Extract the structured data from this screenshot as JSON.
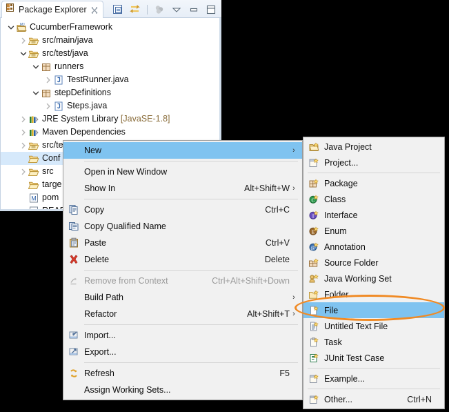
{
  "window": {
    "title": "Package Explorer",
    "accent_selection": "#7fc3f0",
    "annotation_color": "#f08a24"
  },
  "view": {
    "tab": {
      "label": "Package Explorer",
      "icon": "package-explorer-icon",
      "close_icon": "close-icon"
    },
    "toolbar": [
      {
        "name": "collapse-all-button",
        "icon": "collapse-all-icon"
      },
      {
        "name": "link-with-editor-button",
        "icon": "link-editor-icon"
      },
      {
        "name": "focus-on-active-task-button",
        "icon": "focus-task-icon"
      },
      {
        "name": "view-menu-button",
        "icon": "chevron-down-icon"
      },
      {
        "name": "minimize-button",
        "icon": "minimize-icon"
      },
      {
        "name": "maximize-button",
        "icon": "maximize-icon"
      }
    ]
  },
  "tree": [
    {
      "label": "CucumberFramework",
      "icon": "project-icon",
      "indent": 0,
      "twisty": "expanded",
      "selected": false
    },
    {
      "label": "src/main/java",
      "icon": "source-folder-icon",
      "indent": 1,
      "twisty": "collapsed",
      "selected": false
    },
    {
      "label": "src/test/java",
      "icon": "source-folder-icon",
      "indent": 1,
      "twisty": "expanded",
      "selected": false
    },
    {
      "label": "runners",
      "icon": "package-icon",
      "indent": 2,
      "twisty": "expanded",
      "selected": false
    },
    {
      "label": "TestRunner.java",
      "icon": "java-file-icon",
      "indent": 3,
      "twisty": "collapsed",
      "selected": false
    },
    {
      "label": "stepDefinitions",
      "icon": "package-icon",
      "indent": 2,
      "twisty": "expanded",
      "selected": false
    },
    {
      "label": "Steps.java",
      "icon": "java-file-icon",
      "indent": 3,
      "twisty": "collapsed",
      "selected": false
    },
    {
      "label": "JRE System Library",
      "suffix": " [JavaSE-1.8]",
      "icon": "library-icon",
      "indent": 1,
      "twisty": "collapsed",
      "selected": false
    },
    {
      "label": "Maven Dependencies",
      "icon": "library-icon",
      "indent": 1,
      "twisty": "collapsed",
      "selected": false
    },
    {
      "label": "src/test/resources",
      "icon": "source-folder-icon",
      "indent": 1,
      "twisty": "collapsed",
      "selected": false
    },
    {
      "label": "Conf",
      "icon": "folder-icon",
      "indent": 1,
      "twisty": "none",
      "selected": true
    },
    {
      "label": "src",
      "icon": "folder-icon",
      "indent": 1,
      "twisty": "collapsed",
      "selected": false
    },
    {
      "label": "targe",
      "icon": "folder-icon",
      "indent": 1,
      "twisty": "none",
      "selected": false
    },
    {
      "label": "pom",
      "icon": "maven-pom-icon",
      "indent": 1,
      "twisty": "none",
      "selected": false
    },
    {
      "label": "READ",
      "icon": "readme-icon",
      "indent": 1,
      "twisty": "none",
      "selected": false
    }
  ],
  "context_menu": [
    {
      "label": "New",
      "accel": "",
      "icon": "",
      "submenu": true,
      "highlighted": true,
      "disabled": false
    },
    {
      "separator": true
    },
    {
      "label": "Open in New Window",
      "accel": "",
      "icon": "",
      "submenu": false,
      "highlighted": false,
      "disabled": false
    },
    {
      "label": "Show In",
      "accel": "Alt+Shift+W",
      "icon": "",
      "submenu": true,
      "highlighted": false,
      "disabled": false
    },
    {
      "separator": true
    },
    {
      "label": "Copy",
      "accel": "Ctrl+C",
      "icon": "copy-icon",
      "submenu": false,
      "highlighted": false,
      "disabled": false
    },
    {
      "label": "Copy Qualified Name",
      "accel": "",
      "icon": "copy-qualified-icon",
      "submenu": false,
      "highlighted": false,
      "disabled": false
    },
    {
      "label": "Paste",
      "accel": "Ctrl+V",
      "icon": "paste-icon",
      "submenu": false,
      "highlighted": false,
      "disabled": false
    },
    {
      "label": "Delete",
      "accel": "Delete",
      "icon": "delete-icon",
      "submenu": false,
      "highlighted": false,
      "disabled": false
    },
    {
      "separator": true
    },
    {
      "label": "Remove from Context",
      "accel": "Ctrl+Alt+Shift+Down",
      "icon": "remove-context-icon",
      "submenu": false,
      "highlighted": false,
      "disabled": true
    },
    {
      "label": "Build Path",
      "accel": "",
      "icon": "",
      "submenu": true,
      "highlighted": false,
      "disabled": false
    },
    {
      "label": "Refactor",
      "accel": "Alt+Shift+T",
      "icon": "",
      "submenu": true,
      "highlighted": false,
      "disabled": false
    },
    {
      "separator": true
    },
    {
      "label": "Import...",
      "accel": "",
      "icon": "import-icon",
      "submenu": false,
      "highlighted": false,
      "disabled": false
    },
    {
      "label": "Export...",
      "accel": "",
      "icon": "export-icon",
      "submenu": false,
      "highlighted": false,
      "disabled": false
    },
    {
      "separator": true
    },
    {
      "label": "Refresh",
      "accel": "F5",
      "icon": "refresh-icon",
      "submenu": false,
      "highlighted": false,
      "disabled": false
    },
    {
      "label": "Assign Working Sets...",
      "accel": "",
      "icon": "",
      "submenu": false,
      "highlighted": false,
      "disabled": false
    }
  ],
  "new_submenu": [
    {
      "label": "Java Project",
      "accel": "",
      "icon": "java-project-icon",
      "highlighted": false
    },
    {
      "label": "Project...",
      "accel": "",
      "icon": "project-new-icon",
      "highlighted": false
    },
    {
      "separator": true
    },
    {
      "label": "Package",
      "accel": "",
      "icon": "package-new-icon",
      "highlighted": false
    },
    {
      "label": "Class",
      "accel": "",
      "icon": "class-new-icon",
      "highlighted": false
    },
    {
      "label": "Interface",
      "accel": "",
      "icon": "interface-new-icon",
      "highlighted": false
    },
    {
      "label": "Enum",
      "accel": "",
      "icon": "enum-new-icon",
      "highlighted": false
    },
    {
      "label": "Annotation",
      "accel": "",
      "icon": "annotation-new-icon",
      "highlighted": false
    },
    {
      "label": "Source Folder",
      "accel": "",
      "icon": "source-folder-new-icon",
      "highlighted": false
    },
    {
      "label": "Java Working Set",
      "accel": "",
      "icon": "java-working-set-icon",
      "highlighted": false
    },
    {
      "label": "Folder",
      "accel": "",
      "icon": "folder-new-icon",
      "highlighted": false
    },
    {
      "label": "File",
      "accel": "",
      "icon": "file-new-icon",
      "highlighted": true
    },
    {
      "label": "Untitled Text File",
      "accel": "",
      "icon": "text-file-new-icon",
      "highlighted": false
    },
    {
      "label": "Task",
      "accel": "",
      "icon": "task-new-icon",
      "highlighted": false
    },
    {
      "label": "JUnit Test Case",
      "accel": "",
      "icon": "junit-test-icon",
      "highlighted": false
    },
    {
      "separator": true
    },
    {
      "label": "Example...",
      "accel": "",
      "icon": "example-new-icon",
      "highlighted": false
    },
    {
      "separator": true
    },
    {
      "label": "Other...",
      "accel": "Ctrl+N",
      "icon": "other-new-icon",
      "highlighted": false
    }
  ]
}
